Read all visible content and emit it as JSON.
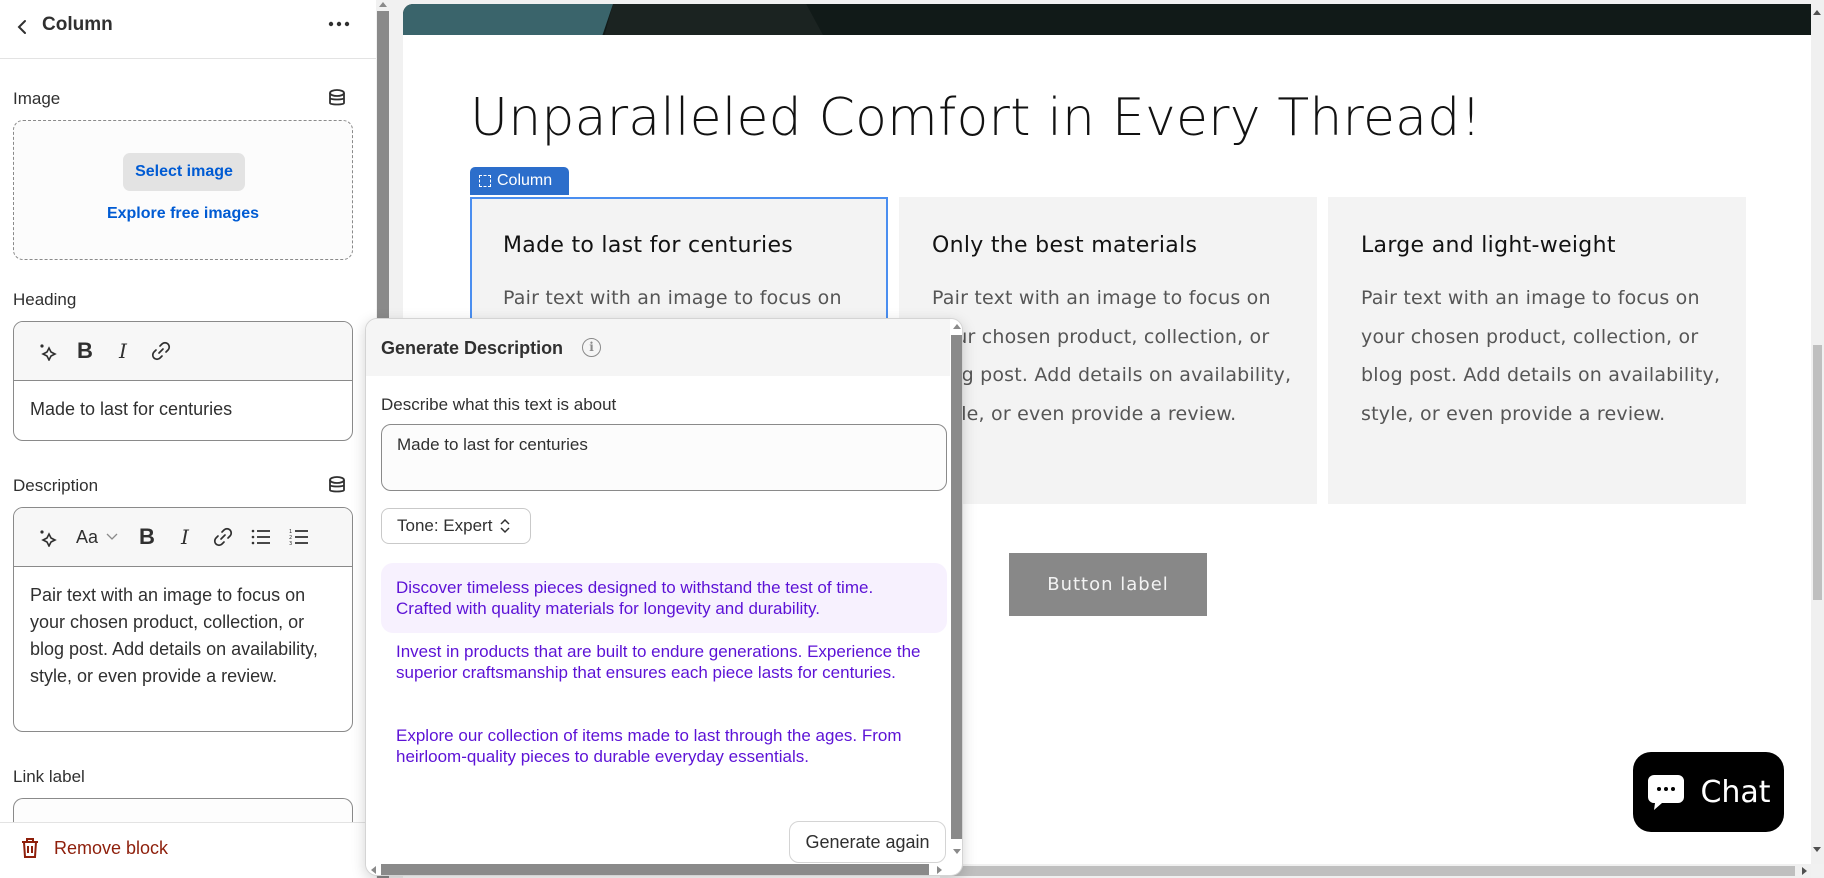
{
  "panel": {
    "title": "Column",
    "back_icon": "chevron-left-icon",
    "more_icon": "ellipsis-horizontal-icon",
    "image": {
      "label": "Image",
      "select_label": "Select image",
      "explore_label": "Explore free images",
      "source_icon": "database-icon"
    },
    "heading": {
      "label": "Heading",
      "toolbar": [
        "magic-icon",
        "bold-icon",
        "italic-icon",
        "link-icon"
      ],
      "value": "Made to last for centuries"
    },
    "description": {
      "label": "Description",
      "source_icon": "database-icon",
      "toolbar": [
        "magic-icon",
        "text-format-icon",
        "bold-icon",
        "italic-icon",
        "link-icon",
        "bullet-list-icon",
        "numbered-list-icon"
      ],
      "font_label": "Aa",
      "value": "Pair text with an image to focus on your chosen product, collection, or blog post. Add details on availability, style, or even provide a review."
    },
    "link_label": {
      "label": "Link label",
      "value": ""
    },
    "remove_label": "Remove block"
  },
  "preview": {
    "title": "Unparalleled Comfort in Every Thread!",
    "selected_tag": "Column",
    "columns": [
      {
        "heading": "Made to last for centuries",
        "text": "Pair text with an image to focus on your chosen product, collection, or blog post. Add details on availability, style, or even provide a review.",
        "selected": true
      },
      {
        "heading": "Only the best materials",
        "text": "Pair text with an image to focus on your chosen product, collection, or blog post. Add details on availability, style, or even provide a review."
      },
      {
        "heading": "Large and light-weight",
        "text": "Pair text with an image to focus on your chosen product, collection, or blog post. Add details on availability, style, or even provide a review."
      }
    ],
    "button_label": "Button label",
    "chat_label": "Chat",
    "colors": {
      "selection": "#2c6ecb",
      "button": "#888888",
      "hero_teal": "#3a646b",
      "hero_dark": "#111a18"
    }
  },
  "generator": {
    "title": "Generate Description",
    "info_icon": "info-icon",
    "prompt_label": "Describe what this text is about",
    "prompt_value": "Made to last for centuries",
    "tone_label": "Tone: Expert",
    "suggestions": [
      "Discover timeless pieces designed to withstand the test of time. Crafted with quality materials for longevity and durability.",
      "Invest in products that are built to endure generations. Experience the superior craftsmanship that ensures each piece lasts for centuries.",
      "Explore our collection of items made to last through the ages. From heirloom-quality pieces to durable everyday essentials."
    ],
    "generate_again_label": "Generate again",
    "suggestion_color": "#5c12d6"
  }
}
